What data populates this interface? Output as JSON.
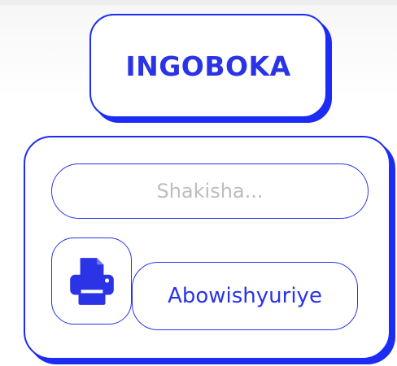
{
  "header": {
    "title": "INGOBOKA"
  },
  "search": {
    "placeholder": "Shakisha...",
    "value": ""
  },
  "actions": {
    "print_icon": "printer-icon",
    "confirmed_label": "Abowishyuriye"
  },
  "colors": {
    "accent": "#1c2cf5",
    "text_accent": "#2a34e6",
    "placeholder": "#bdbdbd",
    "background": "#ffffff"
  }
}
